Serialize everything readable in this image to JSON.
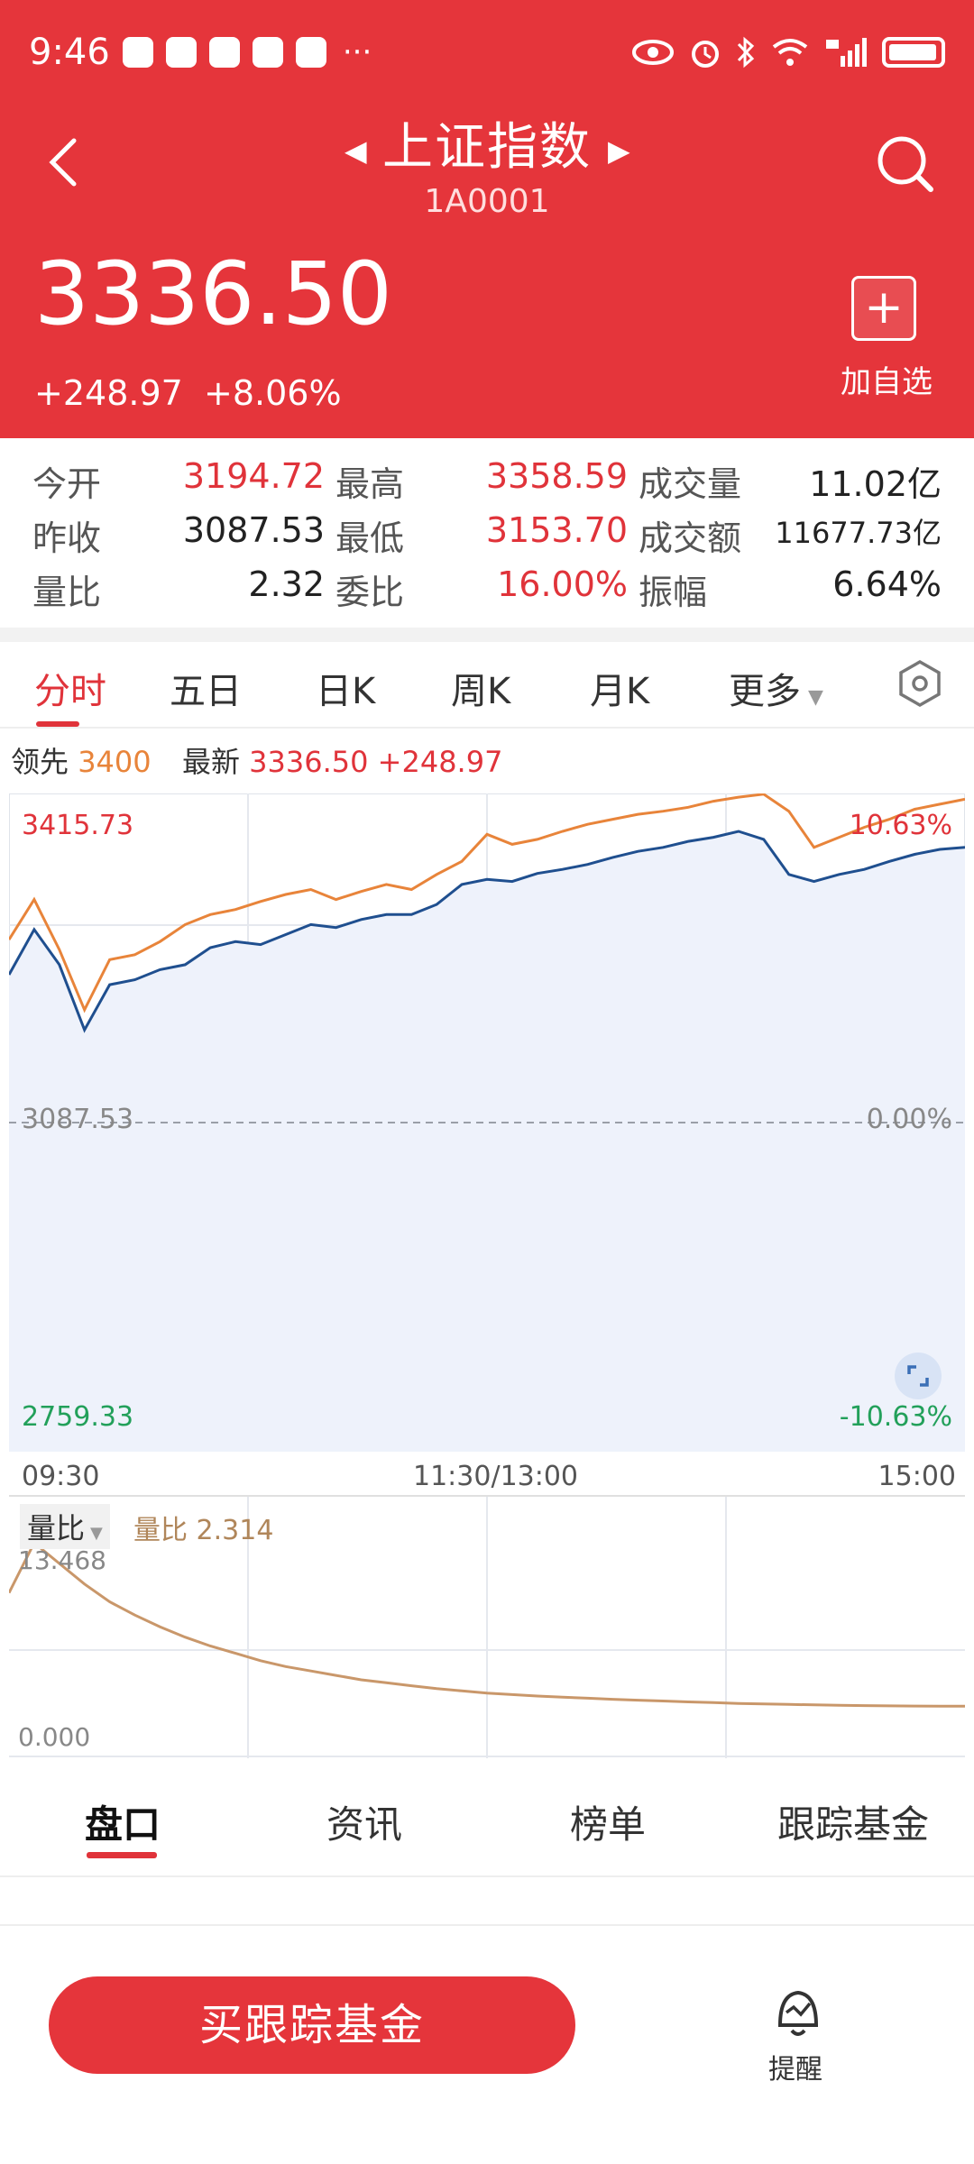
{
  "status_bar": {
    "time": "9:46",
    "more": "···"
  },
  "header": {
    "title": "上证指数",
    "code": "1A0001",
    "price": "3336.50",
    "change": "+248.97",
    "change_pct": "+8.06%",
    "add_label": "加自选",
    "add_symbol": "+"
  },
  "stats": {
    "rows": [
      [
        {
          "label": "今开",
          "value": "3194.72",
          "tone": "red"
        },
        {
          "label": "最高",
          "value": "3358.59",
          "tone": "red"
        },
        {
          "label": "成交量",
          "value": "11.02亿",
          "tone": "dark"
        }
      ],
      [
        {
          "label": "昨收",
          "value": "3087.53",
          "tone": "dark"
        },
        {
          "label": "最低",
          "value": "3153.70",
          "tone": "red"
        },
        {
          "label": "成交额",
          "value": "11677.73亿",
          "tone": "dark"
        }
      ],
      [
        {
          "label": "量比",
          "value": "2.32",
          "tone": "dark"
        },
        {
          "label": "委比",
          "value": "16.00%",
          "tone": "red"
        },
        {
          "label": "振幅",
          "value": "6.64%",
          "tone": "dark"
        }
      ]
    ]
  },
  "tabs": [
    "分时",
    "五日",
    "日K",
    "周K",
    "月K",
    "更多"
  ],
  "legend": {
    "lead_label": "领先",
    "lead_value": "3400",
    "latest_label": "最新",
    "latest_value": "3336.50",
    "latest_change": "+248.97"
  },
  "chart_data": {
    "type": "line",
    "x_labels": [
      "09:30",
      "11:30/13:00",
      "15:00"
    ],
    "ylim": [
      2759.33,
      3415.73
    ],
    "y_labels": {
      "top": "3415.73",
      "mid": "3087.53",
      "bottom": "2759.33"
    },
    "pct_labels": {
      "top": "10.63%",
      "mid": "0.00%",
      "bottom": "-10.63%"
    },
    "series": [
      {
        "color": "#e8843a",
        "values": [
          3270,
          3310,
          3260,
          3200,
          3250,
          3255,
          3268,
          3285,
          3295,
          3300,
          3308,
          3315,
          3320,
          3310,
          3318,
          3325,
          3320,
          3335,
          3348,
          3375,
          3365,
          3370,
          3378,
          3385,
          3390,
          3395,
          3398,
          3402,
          3408,
          3412,
          3415,
          3398,
          3362,
          3372,
          3382,
          3390,
          3400,
          3405,
          3410
        ]
      },
      {
        "color": "#1f4f8f",
        "values": [
          3235,
          3280,
          3245,
          3180,
          3225,
          3230,
          3240,
          3245,
          3262,
          3268,
          3265,
          3275,
          3285,
          3282,
          3290,
          3295,
          3295,
          3305,
          3325,
          3330,
          3328,
          3336,
          3340,
          3345,
          3352,
          3358,
          3362,
          3368,
          3372,
          3378,
          3370,
          3335,
          3328,
          3335,
          3340,
          3348,
          3355,
          3360,
          3362
        ]
      }
    ]
  },
  "volume_ratio": {
    "select_label": "量比",
    "label": "量比",
    "value": "2.314",
    "max_label": "13.468",
    "min_label": "0.000",
    "ylim": [
      0,
      13.468
    ],
    "values": [
      10.0,
      13.4,
      12.0,
      10.6,
      9.4,
      8.5,
      7.7,
      7.0,
      6.4,
      5.9,
      5.4,
      5.0,
      4.7,
      4.4,
      4.1,
      3.9,
      3.7,
      3.5,
      3.35,
      3.2,
      3.1,
      3.0,
      2.92,
      2.85,
      2.78,
      2.72,
      2.66,
      2.6,
      2.55,
      2.5,
      2.46,
      2.43,
      2.4,
      2.37,
      2.35,
      2.33,
      2.32,
      2.315,
      2.314
    ]
  },
  "bottom_tabs": [
    "盘口",
    "资讯",
    "榜单",
    "跟踪基金"
  ],
  "actions": {
    "buy": "买跟踪基金",
    "remind": "提醒"
  },
  "colors": {
    "brand_red": "#e5353b",
    "up_red": "#e0333a",
    "down_green": "#22a05a",
    "lead_orange": "#e8843a",
    "price_blue": "#1f4f8f",
    "fill": "#eef2fb"
  }
}
